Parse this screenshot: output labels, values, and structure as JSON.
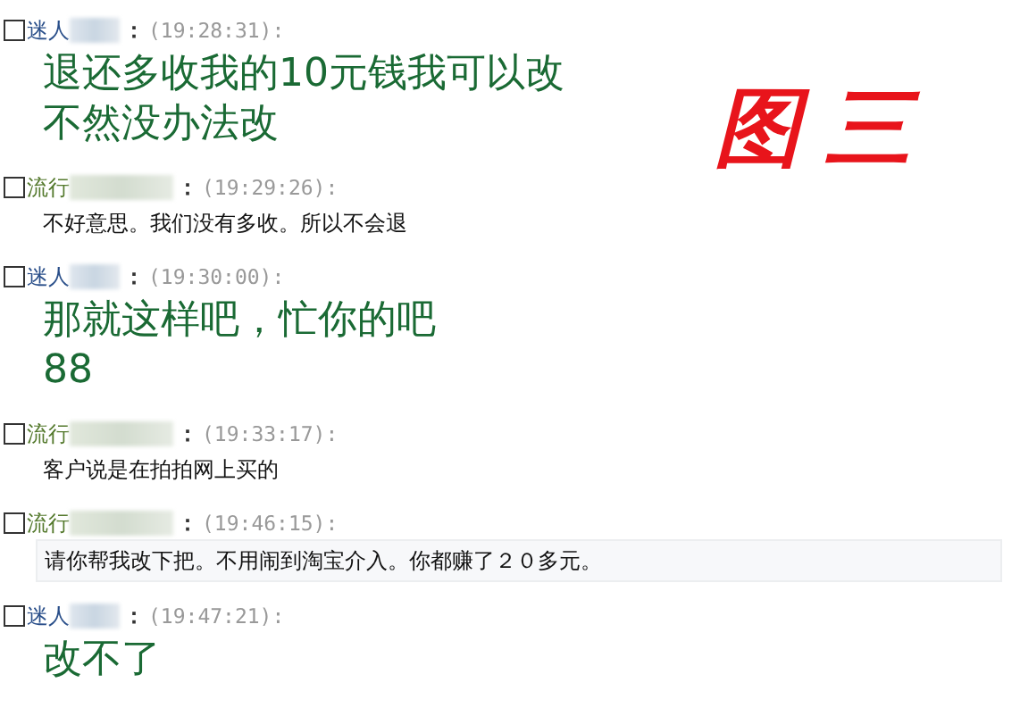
{
  "label": "图三",
  "messages": [
    {
      "kind": "buyer",
      "sender": "迷人",
      "separator": "：",
      "time": "(19:28:31):",
      "checked": false,
      "highlighted": false,
      "lines": [
        "退还多收我的10元钱我可以改",
        "不然没办法改"
      ]
    },
    {
      "kind": "seller",
      "sender": "流行",
      "separator": "：",
      "time": "(19:29:26):",
      "checked": false,
      "highlighted": false,
      "lines": [
        "不好意思。我们没有多收。所以不会退"
      ]
    },
    {
      "kind": "buyer",
      "sender": "迷人",
      "separator": "：",
      "time": "(19:30:00):",
      "checked": false,
      "highlighted": false,
      "lines": [
        "那就这样吧，忙你的吧",
        "88"
      ]
    },
    {
      "kind": "seller",
      "sender": "流行",
      "separator": "：",
      "time": "(19:33:17):",
      "checked": false,
      "highlighted": false,
      "lines": [
        "客户说是在拍拍网上买的"
      ]
    },
    {
      "kind": "seller",
      "sender": "流行",
      "separator": "：",
      "time": "(19:46:15):",
      "checked": false,
      "highlighted": true,
      "lines": [
        "请你帮我改下把。不用闹到淘宝介入。你都赚了２０多元。"
      ]
    },
    {
      "kind": "buyer",
      "sender": "迷人",
      "separator": "：",
      "time": "(19:47:21):",
      "checked": false,
      "highlighted": false,
      "lines": [
        "改不了"
      ]
    }
  ]
}
